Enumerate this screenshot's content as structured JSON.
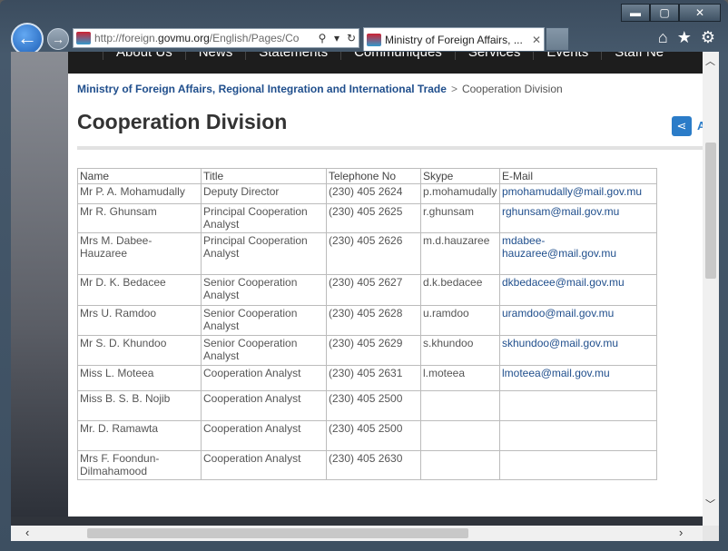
{
  "browser": {
    "url_prefix": "http://foreign.",
    "url_domain": "govmu.org",
    "url_suffix": "/English/Pages/Co",
    "tab_title": "Ministry of Foreign Affairs, ...",
    "tab_close": "✕"
  },
  "nav": {
    "items": [
      "About Us",
      "News",
      "Statements",
      "Communiques",
      "Services",
      "Events",
      "Staff Ne"
    ]
  },
  "breadcrumb": {
    "parent": "Ministry of Foreign Affairs, Regional Integration and International Trade",
    "separator": ">",
    "current": "Cooperation Division"
  },
  "page": {
    "title": "Cooperation Division",
    "share_label": "A"
  },
  "table": {
    "headers": [
      "Name",
      "Title",
      "Telephone No",
      "Skype",
      "E-Mail"
    ],
    "rows": [
      {
        "name": "Mr P. A. Mohamudally",
        "title": "Deputy Director",
        "phone": "(230) 405 2624",
        "skype": "p.mohamudally",
        "email": "pmohamudally@mail.gov.mu"
      },
      {
        "name": "Mr R. Ghunsam",
        "title": "Principal Cooperation Analyst",
        "phone": "(230) 405 2625",
        "skype": "r.ghunsam",
        "email": "rghunsam@mail.gov.mu"
      },
      {
        "name": "Mrs M. Dabee-Hauzaree",
        "title": "Principal Cooperation Analyst",
        "phone": "(230) 405 2626",
        "skype": "m.d.hauzaree",
        "email": "mdabee-hauzaree@mail.gov.mu"
      },
      {
        "name": "Mr D. K. Bedacee",
        "title": "Senior Cooperation Analyst",
        "phone": "(230) 405 2627",
        "skype": "d.k.bedacee",
        "email": "dkbedacee@mail.gov.mu"
      },
      {
        "name": "Mrs U. Ramdoo",
        "title": "Senior Cooperation Analyst",
        "phone": "(230) 405 2628",
        "skype": "u.ramdoo",
        "email": "uramdoo@mail.gov.mu"
      },
      {
        "name": "Mr S. D. Khundoo",
        "title": "Senior Cooperation Analyst",
        "phone": "(230) 405 2629",
        "skype": "s.khundoo",
        "email": "skhundoo@mail.gov.mu"
      },
      {
        "name": "Miss L. Moteea",
        "title": "Cooperation Analyst",
        "phone": "(230) 405 2631",
        "skype": "l.moteea",
        "email": "lmoteea@mail.gov.mu"
      },
      {
        "name": "Miss B. S. B. Nojib",
        "title": "Cooperation Analyst",
        "phone": "(230) 405 2500",
        "skype": "",
        "email": ""
      },
      {
        "name": "Mr. D. Ramawta",
        "title": "Cooperation Analyst",
        "phone": "(230) 405 2500",
        "skype": "",
        "email": ""
      },
      {
        "name": "Mrs F. Foondun-Dilmahamood",
        "title": "Cooperation Analyst",
        "phone": "(230) 405 2630",
        "skype": "",
        "email": ""
      }
    ]
  },
  "colors": {
    "link": "#1f4e8c",
    "nav_bg": "#1d1d1d",
    "browser_frame": "#46596c"
  }
}
